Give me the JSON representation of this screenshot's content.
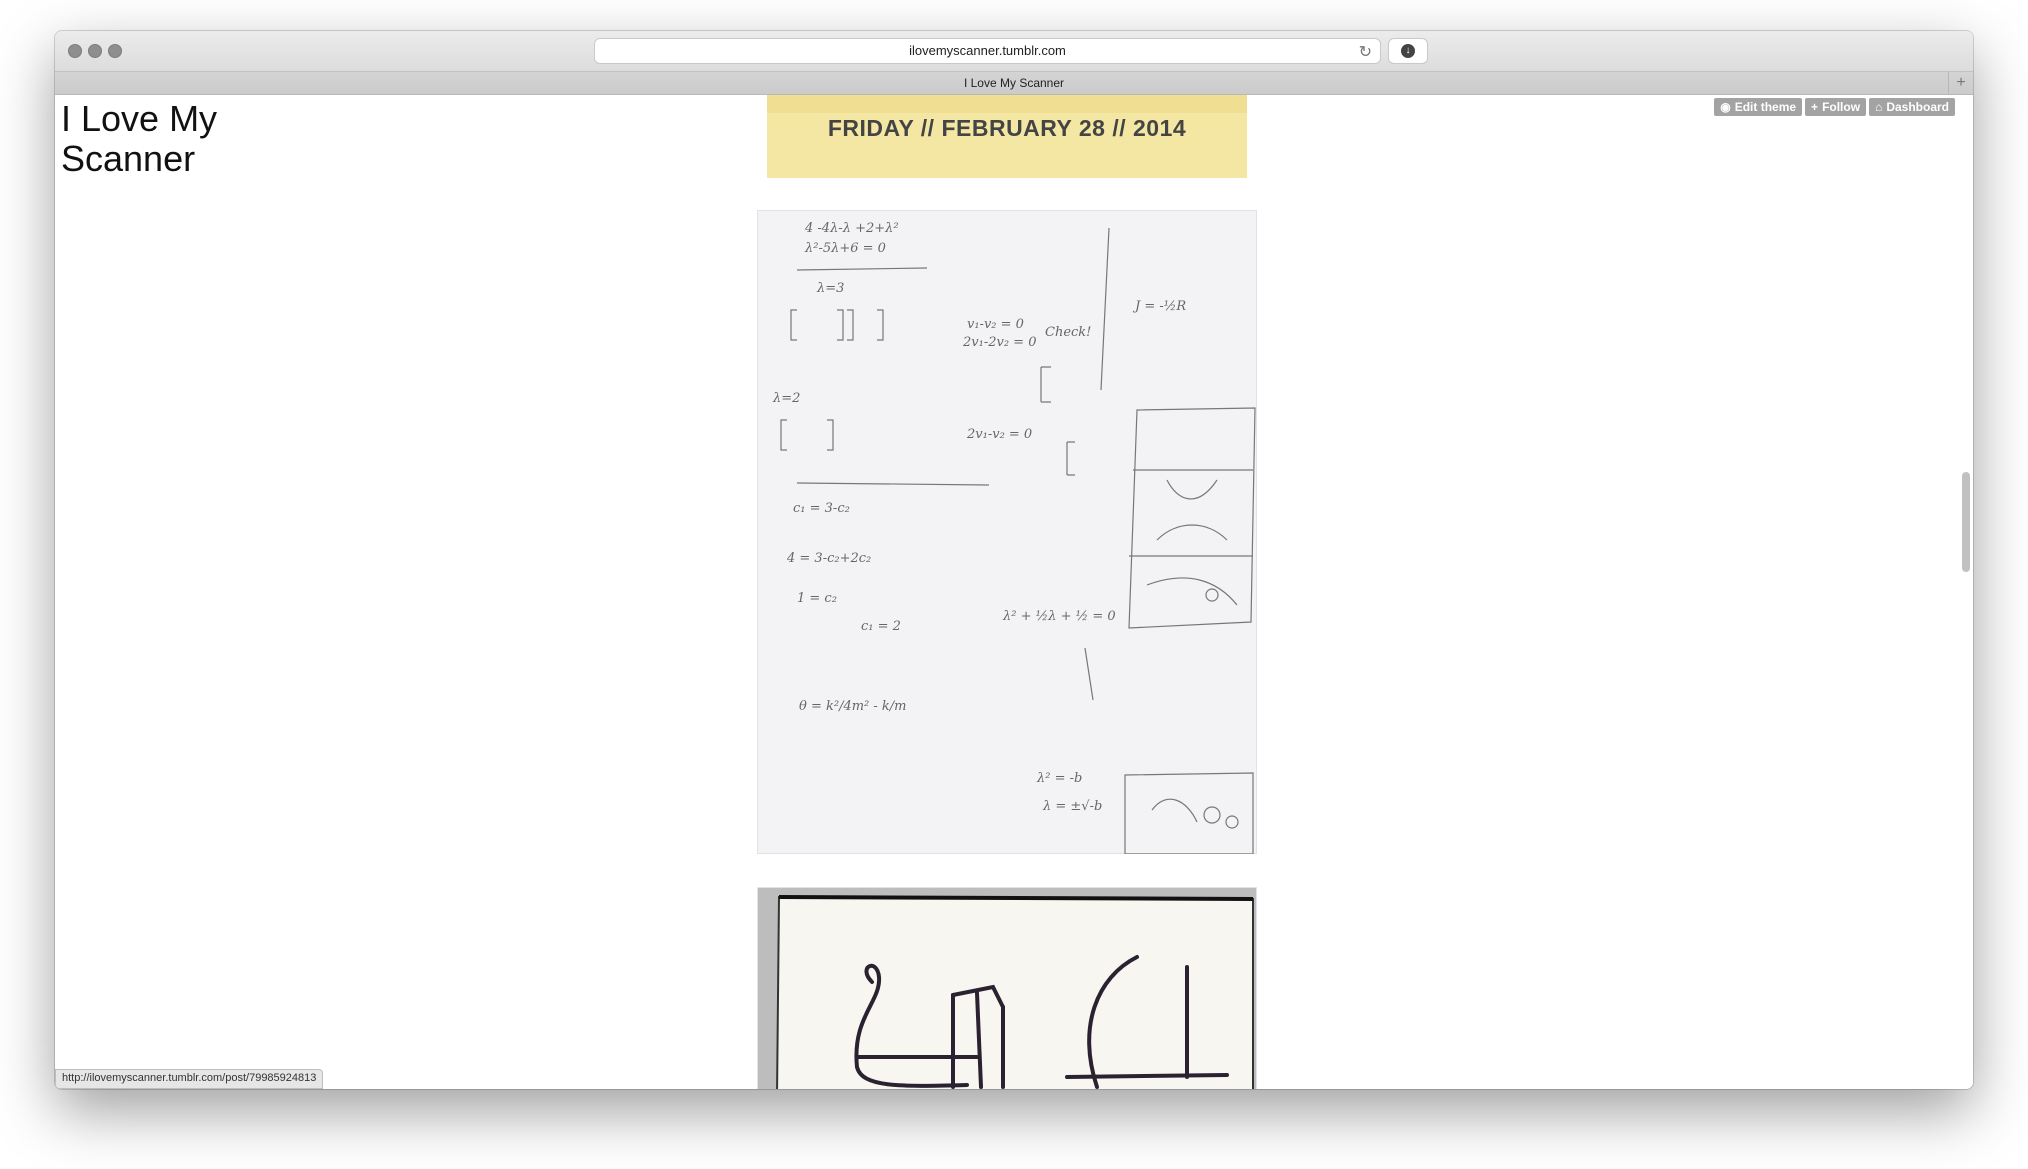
{
  "browser": {
    "url": "ilovemyscanner.tumblr.com",
    "tab_title": "I Love My Scanner",
    "status_url": "http://ilovemyscanner.tumblr.com/post/79985924813"
  },
  "blog": {
    "title": "I Love My Scanner"
  },
  "tumblr_controls": {
    "edit_theme": "Edit theme",
    "follow": "Follow",
    "dashboard": "Dashboard"
  },
  "posts": [
    {
      "date_header": "FRIDAY // FEBRUARY 28 // 2014",
      "scan_text": [
        "4 -4λ-λ +2+λ²",
        "λ²-5λ+6 = 0",
        "λ=3",
        "v₁-v₂ = 0",
        "2v₁-2v₂ = 0",
        "Check!",
        "λ=2",
        "2v₁-v₂ = 0",
        "c₁ = 3-c₂",
        "4 = 3-c₂+2c₂",
        "1 = c₂",
        "c₁ = 2",
        "θ = k²/4m² - k/m",
        "λ² + ½λ + ½ = 0",
        "λ² = -b",
        "λ = ±√-b",
        "J = -½R"
      ]
    },
    {
      "scan_text": [
        "4 4"
      ]
    }
  ],
  "colors": {
    "header_yellow": "#f4e7a4",
    "control_gray": "#a3a3a3"
  }
}
